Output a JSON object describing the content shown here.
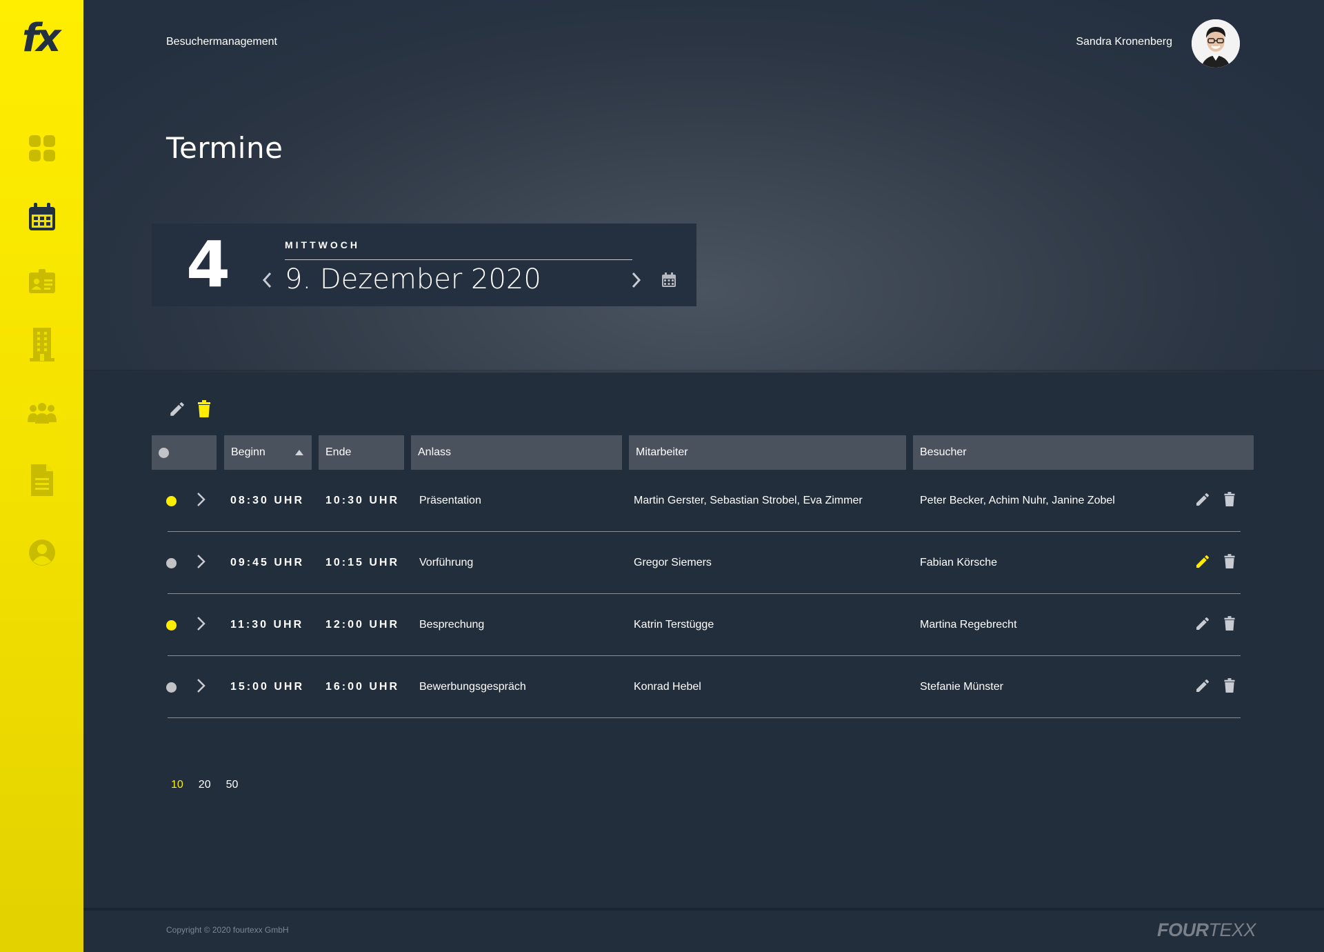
{
  "app": {
    "logo_text": "fx",
    "breadcrumb": "Besuchermanagement",
    "user_name": "Sandra Kronenberg",
    "accent_color": "#ffee00",
    "background_color": "#232e3c"
  },
  "sidebar": {
    "items": [
      {
        "name": "dashboard",
        "icon": "grid-icon"
      },
      {
        "name": "calendar",
        "icon": "calendar-icon",
        "active": true
      },
      {
        "name": "visitor-id",
        "icon": "id-card-icon"
      },
      {
        "name": "building",
        "icon": "building-icon"
      },
      {
        "name": "people",
        "icon": "people-icon"
      },
      {
        "name": "documents",
        "icon": "document-icon"
      },
      {
        "name": "profile",
        "icon": "user-icon"
      }
    ]
  },
  "page": {
    "title": "Termine"
  },
  "date_picker": {
    "count": "4",
    "weekday": "MITTWOCH",
    "date": "9. Dezember 2020"
  },
  "table": {
    "headers": {
      "status": "",
      "begin": "Beginn",
      "end": "Ende",
      "reason": "Anlass",
      "staff": "Mitarbeiter",
      "visitor": "Besucher"
    },
    "sort": {
      "column": "begin",
      "direction": "ascending"
    },
    "rows": [
      {
        "status": "yellow",
        "begin": "08:30 UHR",
        "end": "10:30 UHR",
        "reason": "Präsentation",
        "staff": "Martin Gerster, Sebastian Strobel, Eva Zimmer",
        "visitor": "Peter Becker, Achim Nuhr, Janine Zobel",
        "edit_active": false
      },
      {
        "status": "gray",
        "begin": "09:45 UHR",
        "end": "10:15 UHR",
        "reason": "Vorführung",
        "staff": "Gregor Siemers",
        "visitor": "Fabian Körsche",
        "edit_active": true
      },
      {
        "status": "yellow",
        "begin": "11:30 UHR",
        "end": "12:00 UHR",
        "reason": "Besprechung",
        "staff": "Katrin Terstügge",
        "visitor": "Martina Regebrecht",
        "edit_active": false
      },
      {
        "status": "gray",
        "begin": "15:00 UHR",
        "end": "16:00 UHR",
        "reason": "Bewerbungsgespräch",
        "staff": "Konrad Hebel",
        "visitor": "Stefanie Münster",
        "edit_active": false
      }
    ]
  },
  "pagination": {
    "sizes": [
      "10",
      "20",
      "50"
    ],
    "selected": "10"
  },
  "footer": {
    "copyright": "Copyright © 2020 fourtexx GmbH",
    "brand_bold": "FOUR",
    "brand_thin": "TEXX"
  }
}
